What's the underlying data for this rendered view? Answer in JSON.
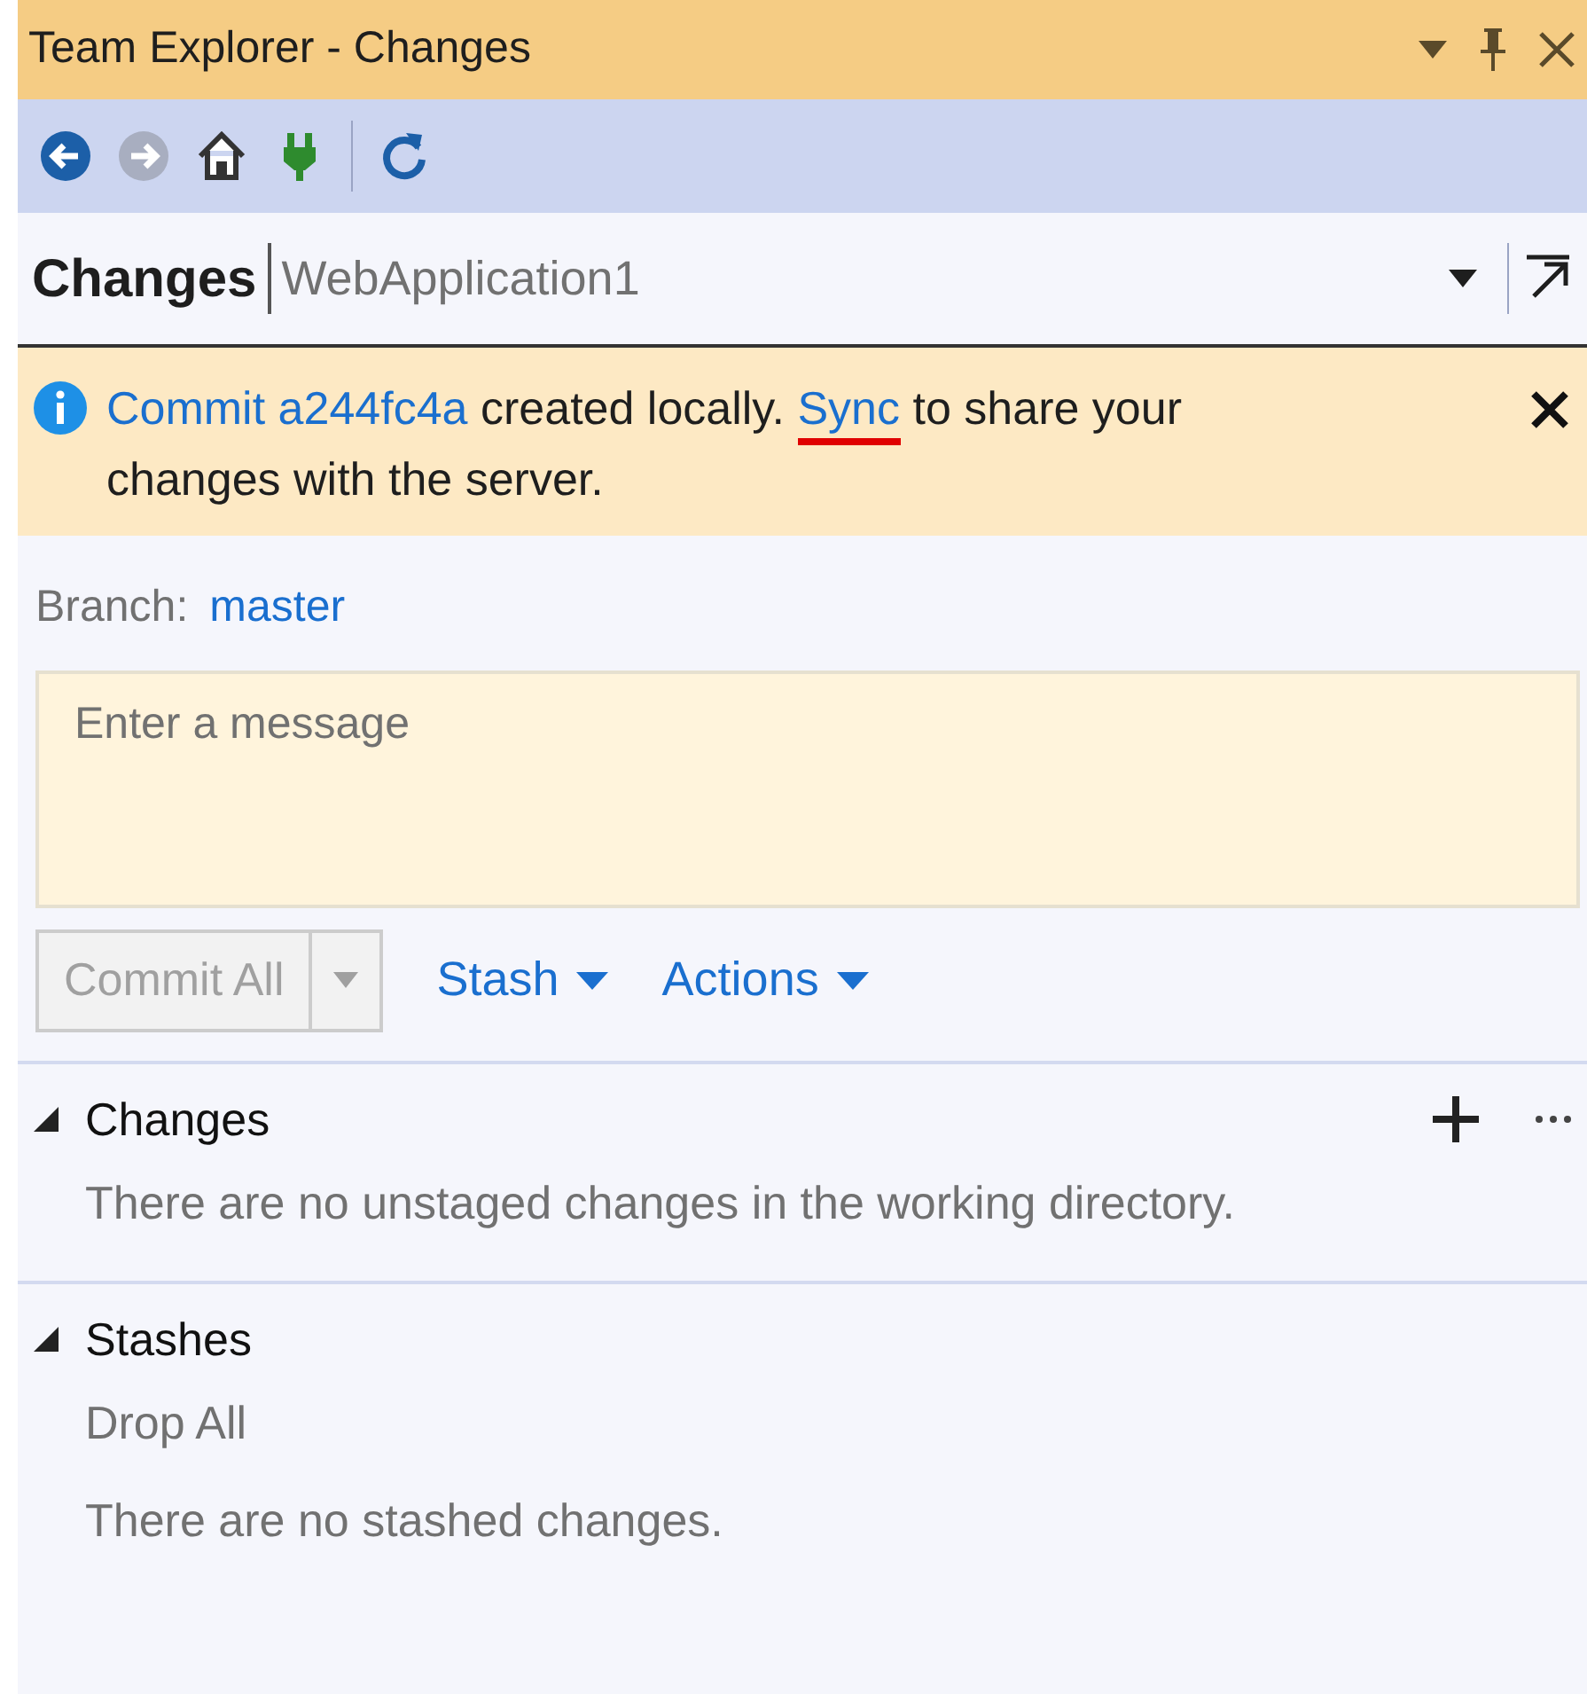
{
  "window": {
    "title": "Team Explorer - Changes"
  },
  "toolbar": [
    {
      "kind": "back",
      "disabled": false
    },
    {
      "kind": "forward",
      "disabled": true
    },
    {
      "kind": "home",
      "disabled": false
    },
    {
      "kind": "connect",
      "disabled": false
    },
    {
      "kind": "refresh",
      "disabled": false
    }
  ],
  "header": {
    "title": "Changes",
    "subtitle": "WebApplication1"
  },
  "notification": {
    "parts": [
      {
        "kind": "link",
        "text": "Commit a244fc4a",
        "highlighted": false
      },
      {
        "kind": "text",
        "text": " created locally. "
      },
      {
        "kind": "link",
        "text": "Sync",
        "highlighted": true
      },
      {
        "kind": "text",
        "text": " to share your changes with the server."
      }
    ]
  },
  "branch": {
    "label": "Branch:",
    "value": "master"
  },
  "message": {
    "placeholder": "Enter a message"
  },
  "commit_button": {
    "label": "Commit All",
    "disabled": true
  },
  "menus": [
    {
      "label": "Stash"
    },
    {
      "label": "Actions"
    }
  ],
  "sections": [
    {
      "title": "Changes",
      "expanded": true,
      "actions": true,
      "items": [
        {
          "kind": "text",
          "text": "There are no unstaged changes in the working directory."
        }
      ]
    },
    {
      "title": "Stashes",
      "expanded": true,
      "actions": false,
      "items": [
        {
          "kind": "action",
          "text": "Drop All",
          "disabled": true
        },
        {
          "kind": "text",
          "text": "There are no stashed changes."
        }
      ]
    }
  ]
}
